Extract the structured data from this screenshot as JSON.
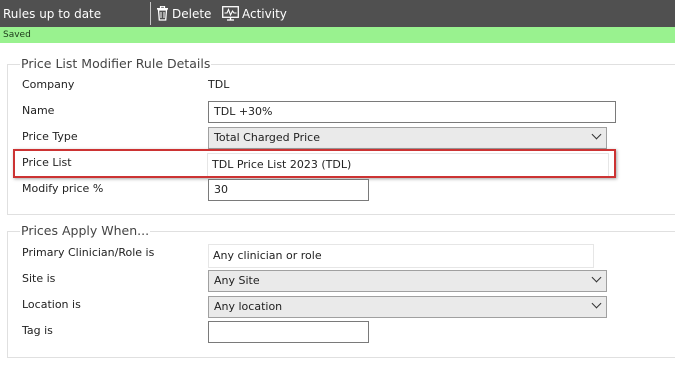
{
  "toolbar": {
    "status": "Rules up to date",
    "delete_label": "Delete",
    "activity_label": "Activity"
  },
  "status_bar": {
    "text": "Saved",
    "color": "#99f28f"
  },
  "details": {
    "title": "Price List Modifier Rule Details",
    "company_label": "Company",
    "company_value": "TDL",
    "name_label": "Name",
    "name_value": "TDL +30%",
    "price_type_label": "Price Type",
    "price_type_value": "Total Charged Price",
    "price_list_label": "Price List",
    "price_list_value": "TDL Price List 2023 (TDL)",
    "modify_label": "Modify price %",
    "modify_value": "30"
  },
  "apply": {
    "title": "Prices Apply When...",
    "clinician_label": "Primary Clinician/Role is",
    "clinician_value": "Any clinician or role",
    "site_label": "Site is",
    "site_value": "Any Site",
    "location_label": "Location is",
    "location_value": "Any location",
    "tag_label": "Tag is",
    "tag_value": ""
  },
  "highlight_color": "#cc3333"
}
